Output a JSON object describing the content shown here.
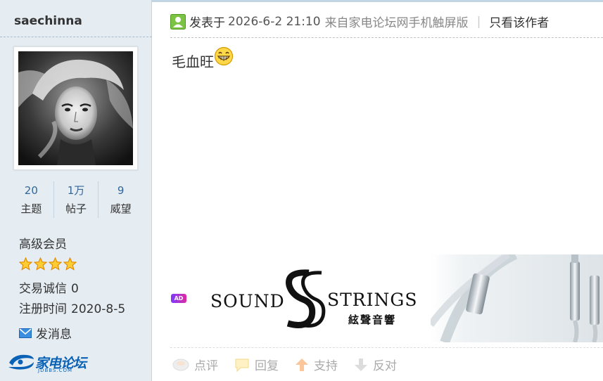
{
  "user": {
    "name": "saechinna",
    "stats": [
      {
        "num": "20",
        "label": "主题"
      },
      {
        "num": "1万",
        "label": "帖子"
      },
      {
        "num": "9",
        "label": "威望"
      }
    ],
    "rank": "高级会员",
    "star_count": 4,
    "trade_label": "交易诚信",
    "trade_value": "0",
    "reg_label": "注册时间",
    "reg_value": "2020-8-5",
    "message_label": "发消息"
  },
  "logo": {
    "text": "家电论坛",
    "sub": "JDBBS.COM"
  },
  "post": {
    "posted_prefix": "发表于",
    "date": "2026-6-2 21:10",
    "source": "来自家电论坛网手机触屏版",
    "separator": "|",
    "only_author": "只看该作者",
    "content": "毛血旺"
  },
  "ad": {
    "badge": "AD",
    "brand_left": "SOUND",
    "brand_right": "STRINGS",
    "brand_cn": "絃聲音響"
  },
  "actions": [
    {
      "label": "点评",
      "icon": "comment-icon"
    },
    {
      "label": "回复",
      "icon": "reply-icon"
    },
    {
      "label": "支持",
      "icon": "thumb-up-arrow-icon"
    },
    {
      "label": "反对",
      "icon": "thumb-down-arrow-icon"
    }
  ],
  "colors": {
    "sidebar_bg": "#e5edf2",
    "link_blue": "#336699",
    "logo_blue": "#0a62b7"
  }
}
